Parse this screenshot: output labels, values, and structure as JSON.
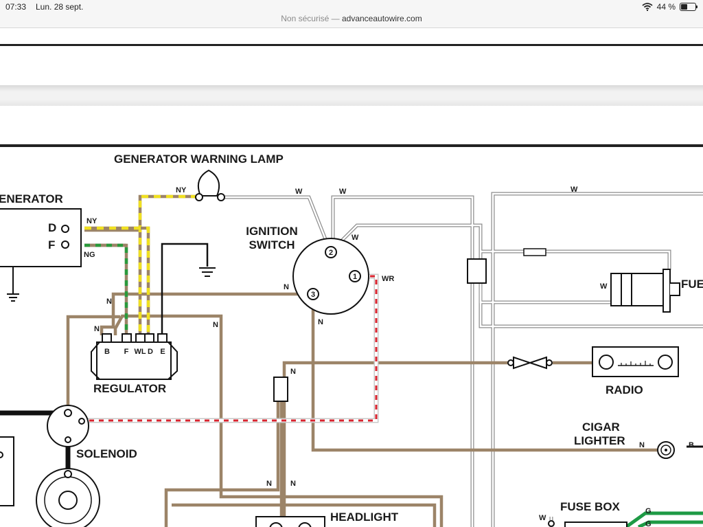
{
  "status": {
    "time": "07:33",
    "date": "Lun. 28 sept.",
    "battery": "44 %",
    "battery_level": 0.44
  },
  "browser": {
    "security": "Non sécurisé —",
    "host": "advanceautowire.com"
  },
  "diagram": {
    "components": {
      "generator": "ENERATOR",
      "warning_lamp": "GENERATOR WARNING LAMP",
      "ignition_switch_1": "IGNITION",
      "ignition_switch_2": "SWITCH",
      "regulator": "REGULATOR",
      "solenoid": "SOLENOID",
      "radio": "RADIO",
      "cigar_lighter_1": "CIGAR",
      "cigar_lighter_2": "LIGHTER",
      "fuse_box": "FUSE BOX",
      "headlight_switch": "HEADLIGHT",
      "fuel": "FUE"
    },
    "terminals": {
      "gen_d": "D",
      "gen_f": "F",
      "reg_b": "B",
      "reg_f": "F",
      "reg_wl": "WL",
      "reg_d": "D",
      "reg_e": "E",
      "ign_1": "1",
      "ign_2": "2",
      "ign_3": "3"
    },
    "wire_labels": {
      "ny_lamp": "NY",
      "ny_gen": "NY",
      "ng_gen": "NG",
      "w1": "W",
      "w2": "W",
      "w3": "W",
      "w4": "W",
      "w_fuel": "W",
      "w_fuse": "W",
      "wr": "WR",
      "n_reg_left": "N",
      "n_reg_b": "N",
      "n_reg_right": "N",
      "n_ign": "N",
      "n_ign_3": "N",
      "n_fuse": "N",
      "n_bottom_1": "N",
      "n_bottom_2": "N",
      "n_cigar": "N",
      "b_cigar": "B",
      "g1": "G",
      "g2": "G"
    },
    "colors": {
      "brown": "#9c8468",
      "red": "#d9232e",
      "yellow": "#f0e020",
      "green": "#2a9a3c",
      "black": "#111111",
      "white_wire": "#8c8c8c",
      "fuse_green": "#1e9a45"
    }
  }
}
